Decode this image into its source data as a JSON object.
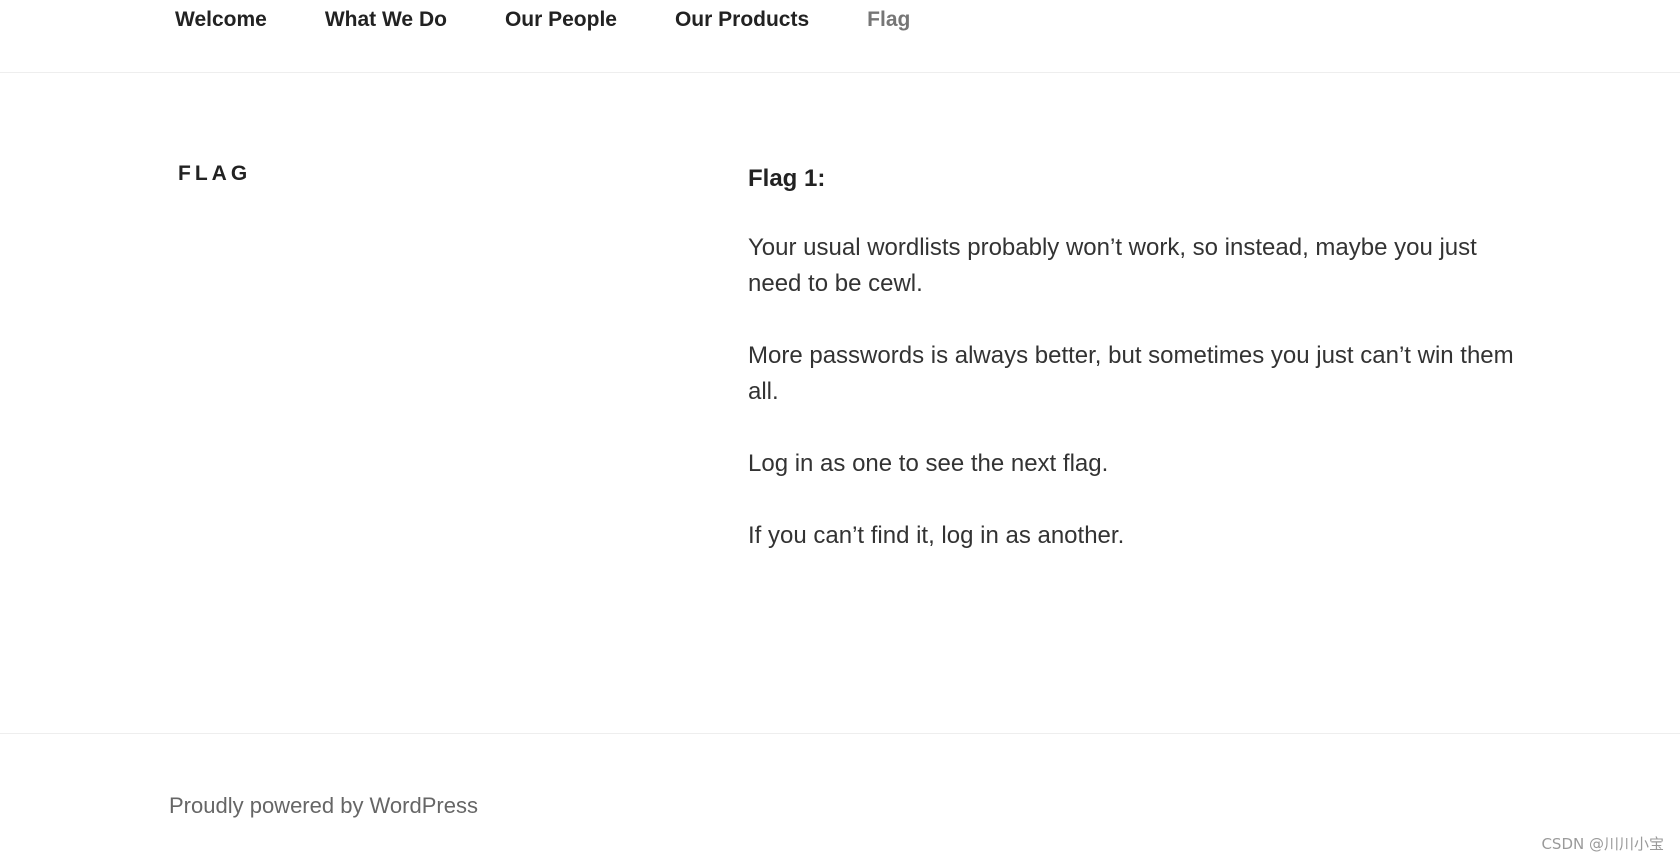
{
  "nav": {
    "items": [
      {
        "label": "Welcome"
      },
      {
        "label": "What We Do"
      },
      {
        "label": "Our People"
      },
      {
        "label": "Our Products"
      },
      {
        "label": "Flag"
      }
    ]
  },
  "page": {
    "title": "FLAG"
  },
  "content": {
    "heading": "Flag 1:",
    "paragraphs": [
      "Your usual wordlists probably won’t work, so instead, maybe you just need to be cewl.",
      "More passwords is always better, but sometimes you just can’t win them all.",
      "Log in as one to see the next flag.",
      "If you can’t find it, log in as another."
    ]
  },
  "footer": {
    "powered_by": "Proudly powered by WordPress"
  },
  "watermark": {
    "text": "CSDN @川川小宝"
  }
}
